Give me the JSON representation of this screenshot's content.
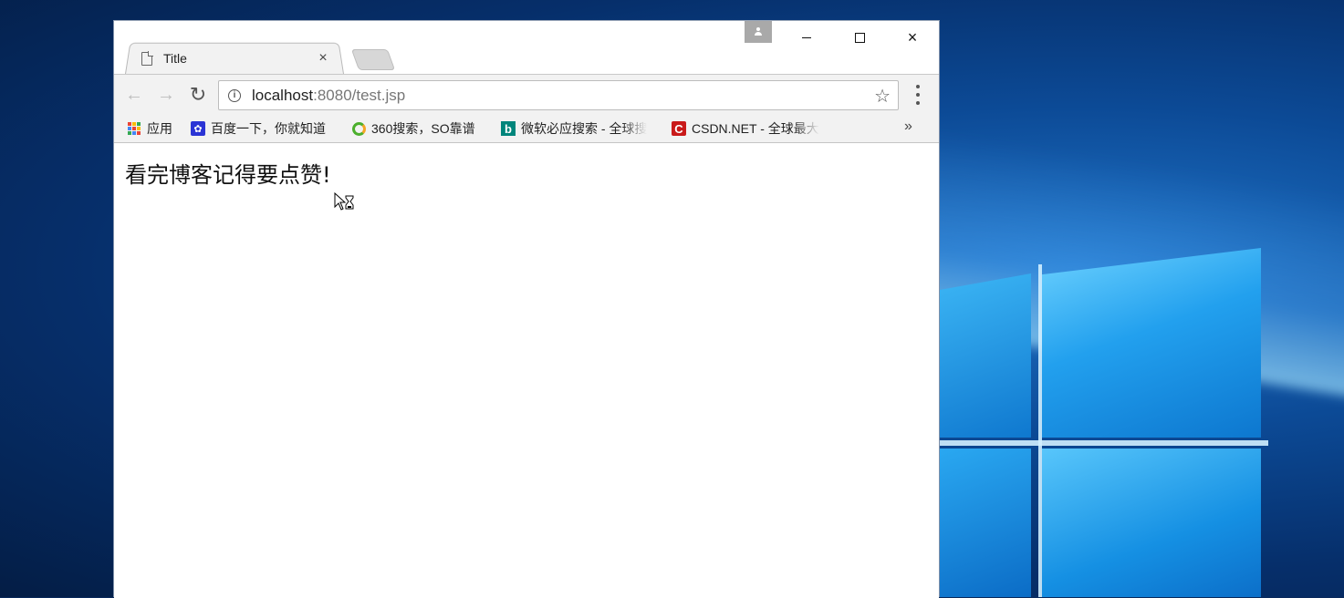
{
  "desktop": {
    "wallpaper": "windows-10-light-pane",
    "accent": "#1a8fe3"
  },
  "browser": {
    "tab": {
      "title": "Title",
      "icon": "file-icon",
      "close": "×"
    },
    "window_controls": {
      "minimize": "minimize-icon",
      "maximize": "maximize-icon",
      "close": "×"
    },
    "toolbar": {
      "url_host": "localhost",
      "url_rest": ":8080/test.jsp",
      "back": "←",
      "forward": "→",
      "reload": "↻",
      "bookmark_star": "☆"
    },
    "bookmarks": [
      {
        "label": "应用",
        "icon": "apps-icon"
      },
      {
        "label": "百度一下，你就知道",
        "icon": "baidu-icon"
      },
      {
        "label": "360搜索，SO靠谱",
        "icon": "360-icon"
      },
      {
        "label": "微软必应搜索 - 全球搜",
        "icon": "bing-icon"
      },
      {
        "label": "CSDN.NET - 全球最大",
        "icon": "csdn-icon"
      }
    ],
    "bookmarks_overflow": "»",
    "page": {
      "heading": "看完博客记得要点赞!"
    }
  }
}
